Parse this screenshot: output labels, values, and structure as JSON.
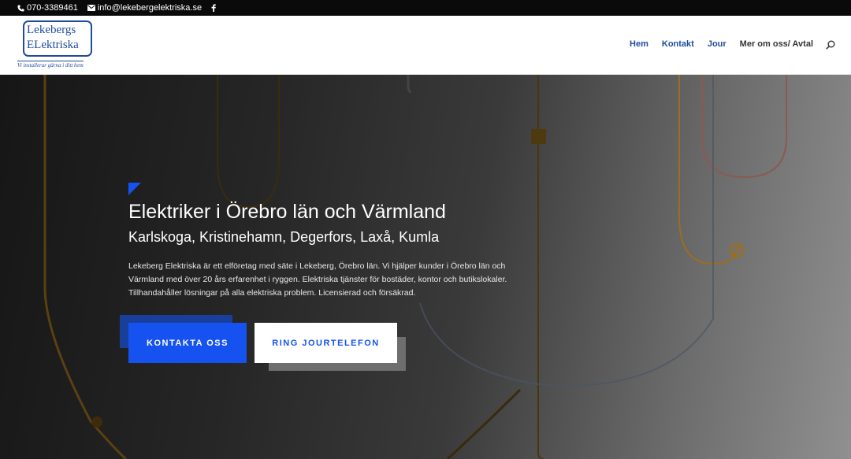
{
  "topbar": {
    "phone": "070-3389461",
    "email": "info@lekebergelektriska.se",
    "icons": [
      "phone-icon",
      "mail-icon",
      "facebook-icon"
    ]
  },
  "logo": {
    "line1": "Lekebergs",
    "line2": "ELektriska",
    "tagline": "Vi installerar gärna i ditt hem"
  },
  "nav": {
    "items": [
      "Hem",
      "Kontakt",
      "Jour",
      "Mer om oss/ Avtal"
    ]
  },
  "hero": {
    "title": "Elektriker i Örebro län och Värmland",
    "subtitle": "Karlskoga, Kristinehamn, Degerfors, Laxå, Kumla",
    "body": "Lekeberg Elektriska är ett elföretag med säte i Lekeberg, Örebro län. Vi hjälper kunder i Örebro län och Värmland med över 20 års erfarenhet i ryggen. Elektriska tjänster för bostäder, kontor och butikslokaler. Tillhandahåller lösningar på alla elektriska problem. Licensierad och försäkrad.",
    "primary_button": "KONTAKTA OSS",
    "secondary_button": "RING JOURTELEFON"
  },
  "colors": {
    "accent": "#1652f0",
    "brand": "#1d4c9c",
    "topbar": "#0a0a0a"
  }
}
